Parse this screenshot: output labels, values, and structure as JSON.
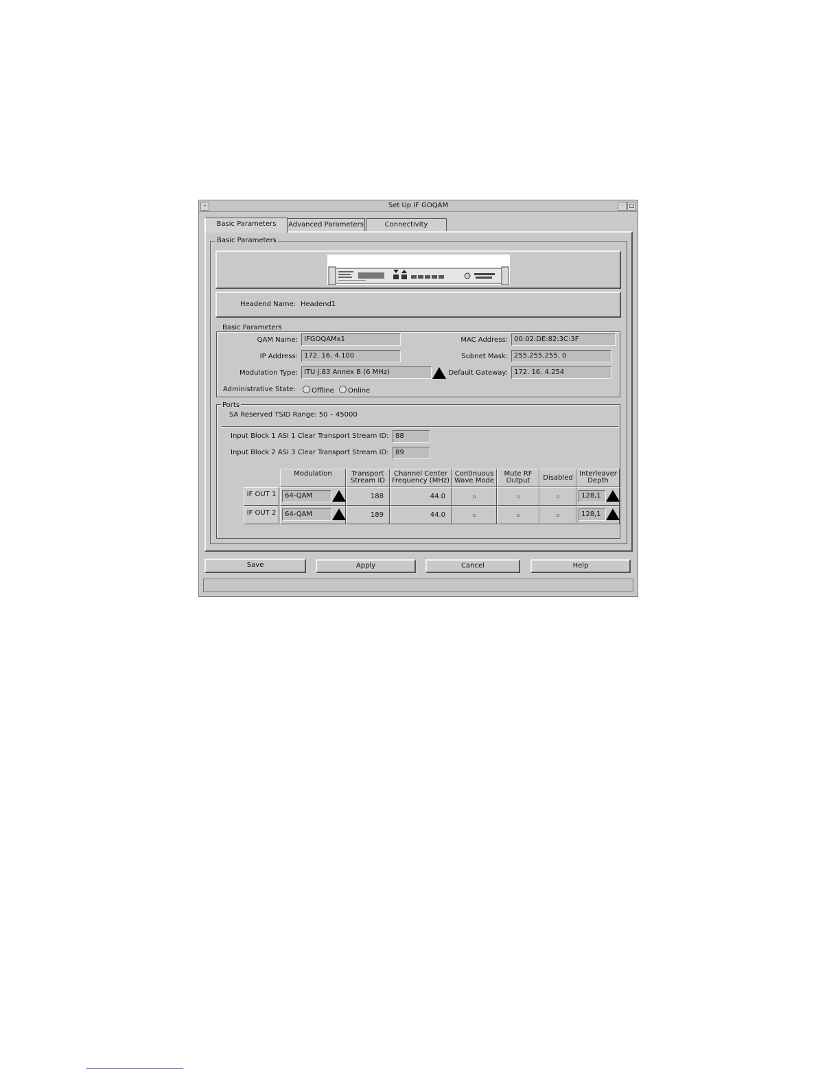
{
  "window": {
    "title": "Set Up IF GOQAM"
  },
  "tabs": [
    {
      "label": "Basic Parameters",
      "active": true
    },
    {
      "label": "Advanced Parameters",
      "active": false
    },
    {
      "label": "Connectivity",
      "active": false
    }
  ],
  "outer_group": {
    "legend": "Basic Parameters"
  },
  "headend": {
    "label": "Headend Name:",
    "value": "Headend1"
  },
  "basic": {
    "legend": "Basic Parameters",
    "qam_name": {
      "label": "QAM Name:",
      "value": "IFGOQAMx1"
    },
    "ip_address": {
      "label": "IP Address:",
      "value": "172. 16.  4.100"
    },
    "modulation_type": {
      "label": "Modulation Type:",
      "value": "ITU J.83 Annex B (6 MHz)"
    },
    "mac_address": {
      "label": "MAC Address:",
      "value": "00:02:DE:82:3C:3F"
    },
    "subnet_mask": {
      "label": "Subnet Mask:",
      "value": "255.255.255.  0"
    },
    "default_gateway": {
      "label": "Default Gateway:",
      "value": "172. 16.  4.254"
    },
    "admin_state": {
      "label": "Administrative State:",
      "offline": "Offline",
      "online": "Online"
    }
  },
  "ports": {
    "legend": "Ports",
    "tsid_range": "SA Reserved TSID Range: 50 – 45000",
    "input_block_1": {
      "label": "Input Block 1 ASI 1 Clear Transport Stream ID:",
      "value": "88"
    },
    "input_block_2": {
      "label": "Input Block 2 ASI 3 Clear Transport Stream ID:",
      "value": "89"
    },
    "table": {
      "headers": {
        "modulation": "Modulation",
        "tsid_1": "Transport",
        "tsid_2": "Stream ID",
        "freq_1": "Channel Center",
        "freq_2": "Frequency (MHz)",
        "cw_1": "Continuous",
        "cw_2": "Wave Mode",
        "mute_1": "Mute RF",
        "mute_2": "Output",
        "disabled": "Disabled",
        "interleaver_1": "Interleaver",
        "interleaver_2": "Depth"
      },
      "rows": [
        {
          "label": "IF OUT 1",
          "modulation": "64-QAM",
          "tsid": "188",
          "freq": "44.0",
          "interleaver": "128,1"
        },
        {
          "label": "IF OUT 2",
          "modulation": "64-QAM",
          "tsid": "189",
          "freq": "44.0",
          "interleaver": "128,1"
        }
      ]
    }
  },
  "buttons": {
    "save": "Save",
    "apply": "Apply",
    "cancel": "Cancel",
    "help": "Help"
  },
  "icons": {
    "dropdown": "triangle-up-icon",
    "window_min": "minimize-icon",
    "window_max": "maximize-icon"
  }
}
